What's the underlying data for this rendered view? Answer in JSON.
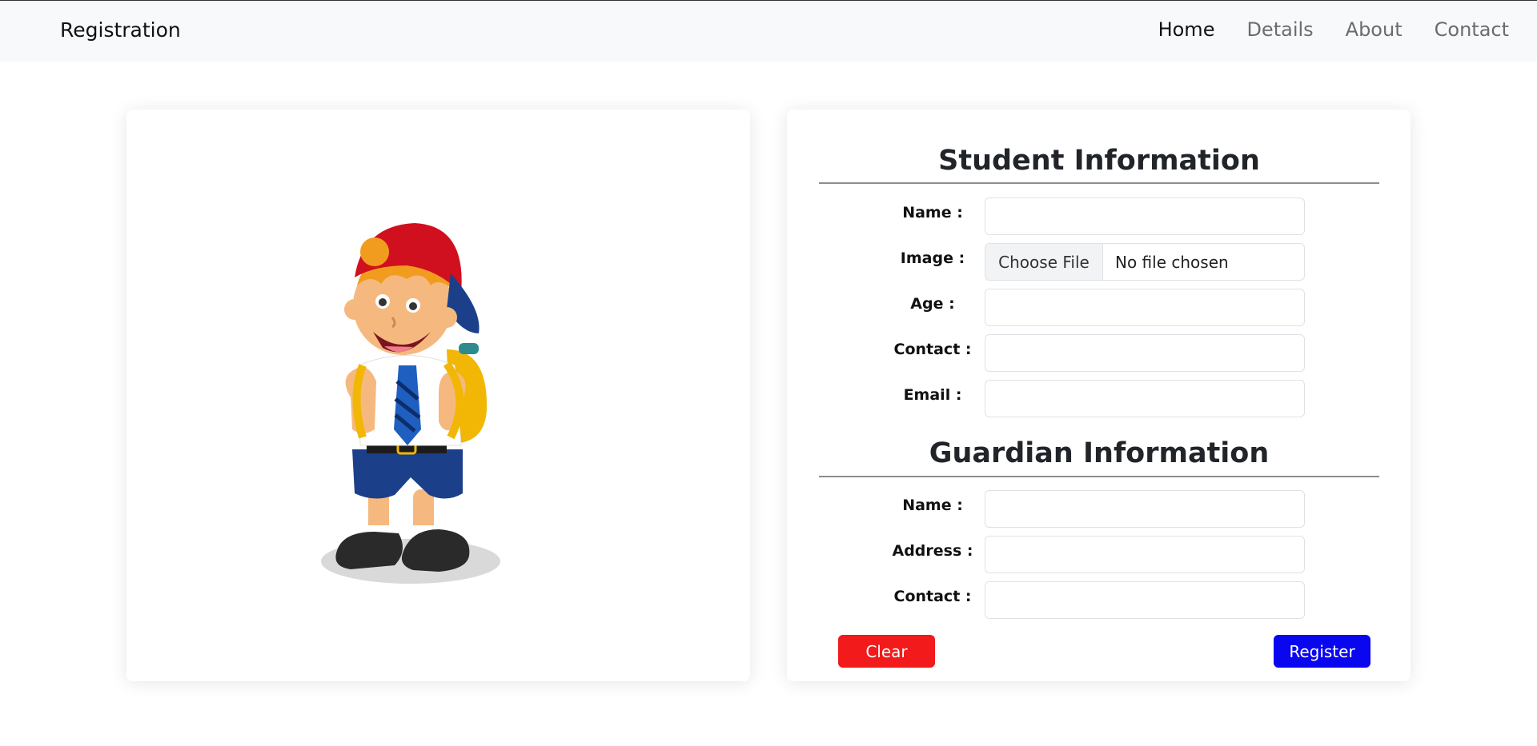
{
  "navbar": {
    "brand": "Registration",
    "links": [
      "Home",
      "Details",
      "About",
      "Contact"
    ]
  },
  "student": {
    "title": "Student Information",
    "labels": {
      "name": "Name :",
      "image": "Image :",
      "age": "Age :",
      "contact": "Contact :",
      "email": "Email :"
    },
    "file": {
      "button": "Choose File",
      "status": "No file chosen"
    }
  },
  "guardian": {
    "title": "Guardian Information",
    "labels": {
      "name": "Name :",
      "address": "Address :",
      "contact": "Contact :"
    }
  },
  "buttons": {
    "clear": "Clear",
    "register": "Register"
  },
  "colors": {
    "clear": "#f21a1a",
    "register": "#0a06f0",
    "navbar_bg": "#f8f9fa"
  },
  "illustration": "schoolboy-with-cap-and-backpack"
}
